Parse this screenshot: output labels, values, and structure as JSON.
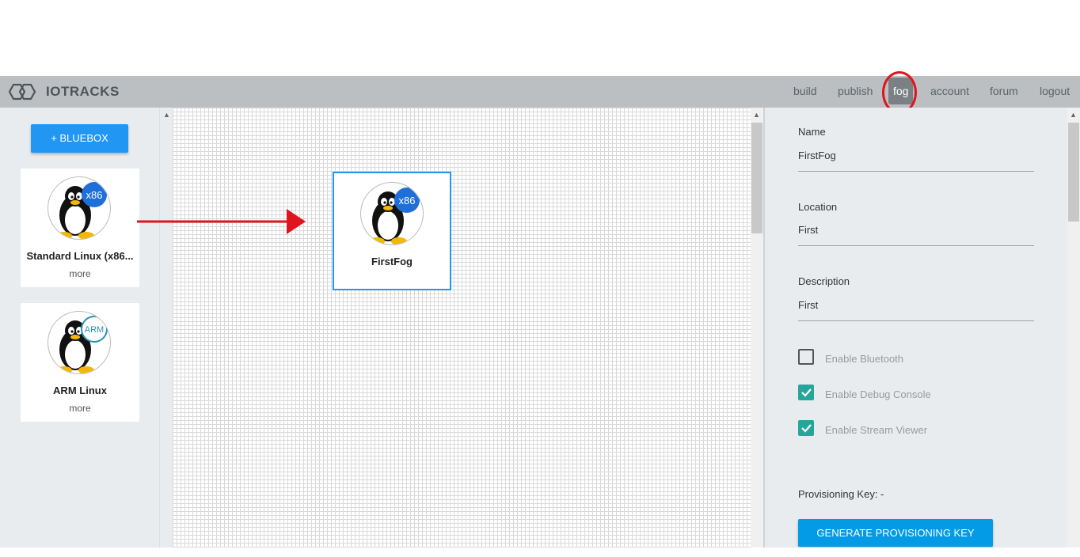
{
  "nav": {
    "brand": "IOTRACKS",
    "links": [
      {
        "label": "build"
      },
      {
        "label": "publish"
      },
      {
        "label": "fog"
      },
      {
        "label": "account"
      },
      {
        "label": "forum"
      },
      {
        "label": "logout"
      }
    ],
    "active": "fog"
  },
  "sidebar": {
    "add_button": "+ BLUEBOX",
    "cards": [
      {
        "title": "Standard Linux (x86...",
        "more": "more",
        "badge": "x86"
      },
      {
        "title": "ARM Linux",
        "more": "more",
        "badge": "ARM"
      }
    ]
  },
  "canvas": {
    "node": {
      "title": "FirstFog",
      "badge": "x86"
    }
  },
  "details": {
    "name_label": "Name",
    "name_value": "FirstFog",
    "location_label": "Location",
    "location_value": "First",
    "description_label": "Description",
    "description_value": "First",
    "checkboxes": [
      {
        "label": "Enable Bluetooth",
        "checked": false
      },
      {
        "label": "Enable Debug Console",
        "checked": true
      },
      {
        "label": "Enable Stream Viewer",
        "checked": true
      }
    ],
    "provisioning_key": "Provisioning Key: -",
    "generate_button": "GENERATE PROVISIONING KEY"
  },
  "colors": {
    "primary": "#2196f3",
    "checkbox_on": "#26a69a",
    "annotation_red": "#e0141e",
    "navbar": "#bcbfc1"
  }
}
